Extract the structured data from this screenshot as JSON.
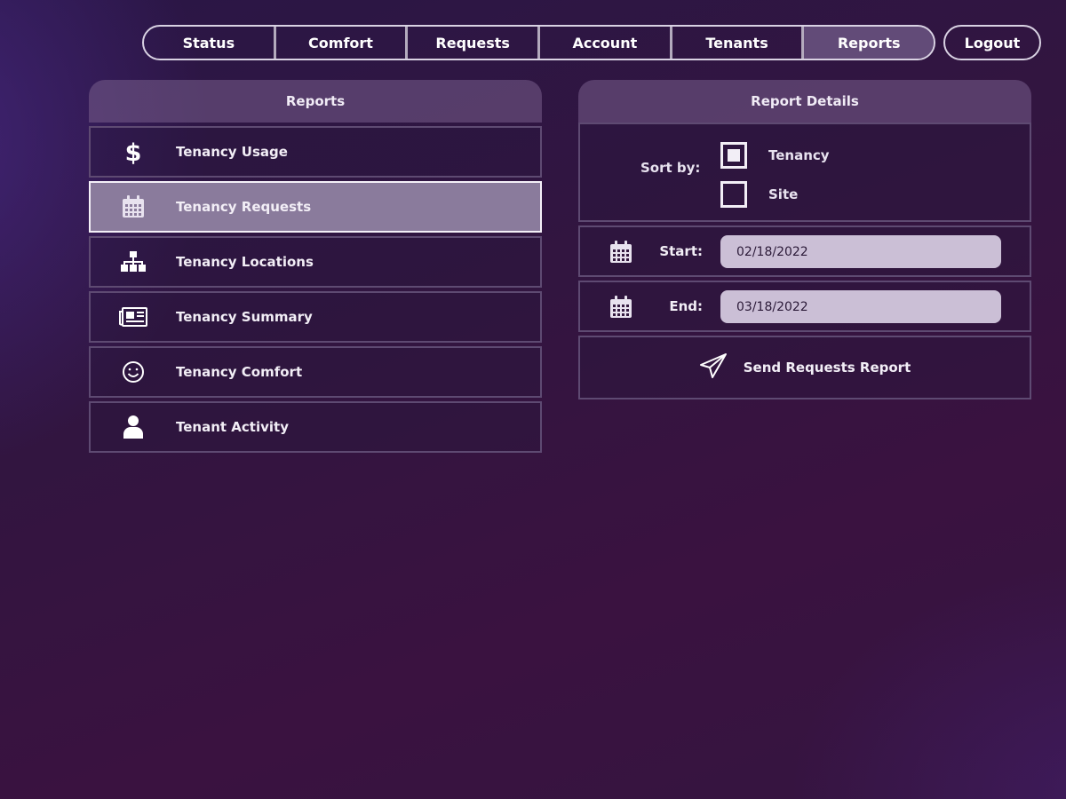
{
  "nav": {
    "tabs": [
      {
        "label": "Status"
      },
      {
        "label": "Comfort"
      },
      {
        "label": "Requests"
      },
      {
        "label": "Account"
      },
      {
        "label": "Tenants"
      },
      {
        "label": "Reports",
        "active": true
      }
    ],
    "logout_label": "Logout"
  },
  "reports": {
    "title": "Reports",
    "items": [
      {
        "label": "Tenancy Usage",
        "icon": "dollar-icon"
      },
      {
        "label": "Tenancy Requests",
        "icon": "calendar-icon",
        "selected": true
      },
      {
        "label": "Tenancy Locations",
        "icon": "sitemap-icon"
      },
      {
        "label": "Tenancy Summary",
        "icon": "newspaper-icon"
      },
      {
        "label": "Tenancy Comfort",
        "icon": "smile-icon"
      },
      {
        "label": "Tenant Activity",
        "icon": "user-icon"
      }
    ]
  },
  "details": {
    "title": "Report Details",
    "sort_label": "Sort by:",
    "sort_options": [
      {
        "label": "Tenancy",
        "checked": true
      },
      {
        "label": "Site",
        "checked": false
      }
    ],
    "start_label": "Start:",
    "start_value": "02/18/2022",
    "end_label": "End:",
    "end_value": "03/18/2022",
    "send_label": "Send Requests Report"
  },
  "colors": {
    "accent_selected": "#8a7b9c",
    "panel_header": "#6e5682",
    "input_bg": "#cbbfd6"
  }
}
